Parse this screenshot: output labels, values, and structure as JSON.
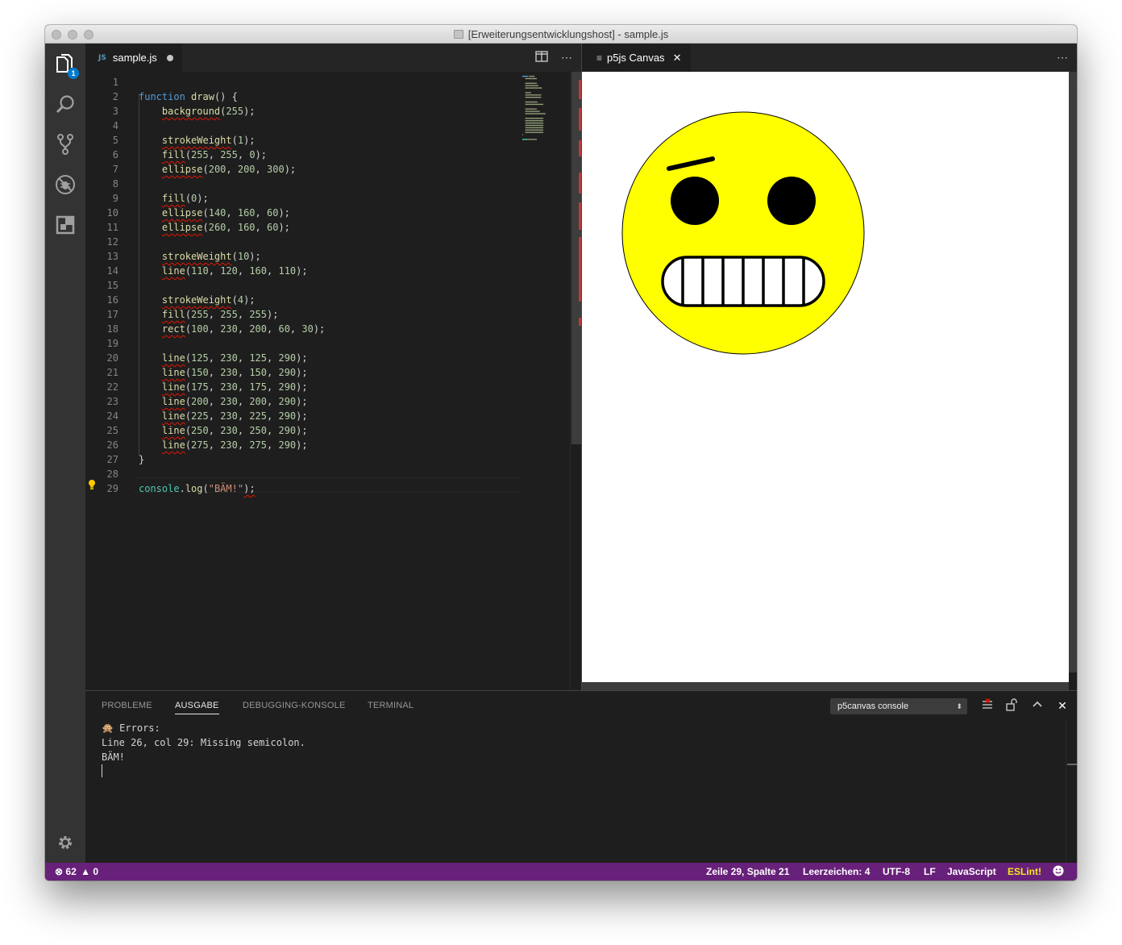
{
  "window": {
    "title": "[Erweiterungsentwicklungshost] - sample.js"
  },
  "activity_bar": {
    "explorer_badge": "1"
  },
  "editor": {
    "tab": {
      "icon_label": "JS",
      "filename": "sample.js"
    },
    "lines": [
      {
        "n": "1",
        "parts": []
      },
      {
        "n": "2",
        "parts": [
          {
            "t": "function",
            "c": "k-kw"
          },
          {
            "t": " "
          },
          {
            "t": "draw",
            "c": "k-fn"
          },
          {
            "t": "() {"
          }
        ]
      },
      {
        "n": "3",
        "parts": [
          {
            "t": "    "
          },
          {
            "t": "background",
            "c": "k-fn squig"
          },
          {
            "t": "("
          },
          {
            "t": "255",
            "c": "k-num"
          },
          {
            "t": ");"
          }
        ]
      },
      {
        "n": "4",
        "parts": []
      },
      {
        "n": "5",
        "parts": [
          {
            "t": "    "
          },
          {
            "t": "strokeWeight",
            "c": "k-fn squig"
          },
          {
            "t": "("
          },
          {
            "t": "1",
            "c": "k-num"
          },
          {
            "t": ");"
          }
        ]
      },
      {
        "n": "6",
        "parts": [
          {
            "t": "    "
          },
          {
            "t": "fill",
            "c": "k-fn squig"
          },
          {
            "t": "("
          },
          {
            "t": "255",
            "c": "k-num"
          },
          {
            "t": ", "
          },
          {
            "t": "255",
            "c": "k-num"
          },
          {
            "t": ", "
          },
          {
            "t": "0",
            "c": "k-num"
          },
          {
            "t": ");"
          }
        ]
      },
      {
        "n": "7",
        "parts": [
          {
            "t": "    "
          },
          {
            "t": "ellipse",
            "c": "k-fn squig"
          },
          {
            "t": "("
          },
          {
            "t": "200",
            "c": "k-num"
          },
          {
            "t": ", "
          },
          {
            "t": "200",
            "c": "k-num"
          },
          {
            "t": ", "
          },
          {
            "t": "300",
            "c": "k-num"
          },
          {
            "t": ");"
          }
        ]
      },
      {
        "n": "8",
        "parts": []
      },
      {
        "n": "9",
        "parts": [
          {
            "t": "    "
          },
          {
            "t": "fill",
            "c": "k-fn squig"
          },
          {
            "t": "("
          },
          {
            "t": "0",
            "c": "k-num"
          },
          {
            "t": ");"
          }
        ]
      },
      {
        "n": "10",
        "parts": [
          {
            "t": "    "
          },
          {
            "t": "ellipse",
            "c": "k-fn squig"
          },
          {
            "t": "("
          },
          {
            "t": "140",
            "c": "k-num"
          },
          {
            "t": ", "
          },
          {
            "t": "160",
            "c": "k-num"
          },
          {
            "t": ", "
          },
          {
            "t": "60",
            "c": "k-num"
          },
          {
            "t": ");"
          }
        ]
      },
      {
        "n": "11",
        "parts": [
          {
            "t": "    "
          },
          {
            "t": "ellipse",
            "c": "k-fn squig"
          },
          {
            "t": "("
          },
          {
            "t": "260",
            "c": "k-num"
          },
          {
            "t": ", "
          },
          {
            "t": "160",
            "c": "k-num"
          },
          {
            "t": ", "
          },
          {
            "t": "60",
            "c": "k-num"
          },
          {
            "t": ");"
          }
        ]
      },
      {
        "n": "12",
        "parts": []
      },
      {
        "n": "13",
        "parts": [
          {
            "t": "    "
          },
          {
            "t": "strokeWeight",
            "c": "k-fn squig"
          },
          {
            "t": "("
          },
          {
            "t": "10",
            "c": "k-num"
          },
          {
            "t": ");"
          }
        ]
      },
      {
        "n": "14",
        "parts": [
          {
            "t": "    "
          },
          {
            "t": "line",
            "c": "k-fn squig"
          },
          {
            "t": "("
          },
          {
            "t": "110",
            "c": "k-num"
          },
          {
            "t": ", "
          },
          {
            "t": "120",
            "c": "k-num"
          },
          {
            "t": ", "
          },
          {
            "t": "160",
            "c": "k-num"
          },
          {
            "t": ", "
          },
          {
            "t": "110",
            "c": "k-num"
          },
          {
            "t": ");"
          }
        ]
      },
      {
        "n": "15",
        "parts": []
      },
      {
        "n": "16",
        "parts": [
          {
            "t": "    "
          },
          {
            "t": "strokeWeight",
            "c": "k-fn squig"
          },
          {
            "t": "("
          },
          {
            "t": "4",
            "c": "k-num"
          },
          {
            "t": ");"
          }
        ]
      },
      {
        "n": "17",
        "parts": [
          {
            "t": "    "
          },
          {
            "t": "fill",
            "c": "k-fn squig"
          },
          {
            "t": "("
          },
          {
            "t": "255",
            "c": "k-num"
          },
          {
            "t": ", "
          },
          {
            "t": "255",
            "c": "k-num"
          },
          {
            "t": ", "
          },
          {
            "t": "255",
            "c": "k-num"
          },
          {
            "t": ");"
          }
        ]
      },
      {
        "n": "18",
        "parts": [
          {
            "t": "    "
          },
          {
            "t": "rect",
            "c": "k-fn squig"
          },
          {
            "t": "("
          },
          {
            "t": "100",
            "c": "k-num"
          },
          {
            "t": ", "
          },
          {
            "t": "230",
            "c": "k-num"
          },
          {
            "t": ", "
          },
          {
            "t": "200",
            "c": "k-num"
          },
          {
            "t": ", "
          },
          {
            "t": "60",
            "c": "k-num"
          },
          {
            "t": ", "
          },
          {
            "t": "30",
            "c": "k-num"
          },
          {
            "t": ");"
          }
        ]
      },
      {
        "n": "19",
        "parts": []
      },
      {
        "n": "20",
        "parts": [
          {
            "t": "    "
          },
          {
            "t": "line",
            "c": "k-fn squig"
          },
          {
            "t": "("
          },
          {
            "t": "125",
            "c": "k-num"
          },
          {
            "t": ", "
          },
          {
            "t": "230",
            "c": "k-num"
          },
          {
            "t": ", "
          },
          {
            "t": "125",
            "c": "k-num"
          },
          {
            "t": ", "
          },
          {
            "t": "290",
            "c": "k-num"
          },
          {
            "t": ");"
          }
        ]
      },
      {
        "n": "21",
        "parts": [
          {
            "t": "    "
          },
          {
            "t": "line",
            "c": "k-fn squig"
          },
          {
            "t": "("
          },
          {
            "t": "150",
            "c": "k-num"
          },
          {
            "t": ", "
          },
          {
            "t": "230",
            "c": "k-num"
          },
          {
            "t": ", "
          },
          {
            "t": "150",
            "c": "k-num"
          },
          {
            "t": ", "
          },
          {
            "t": "290",
            "c": "k-num"
          },
          {
            "t": ");"
          }
        ]
      },
      {
        "n": "22",
        "parts": [
          {
            "t": "    "
          },
          {
            "t": "line",
            "c": "k-fn squig"
          },
          {
            "t": "("
          },
          {
            "t": "175",
            "c": "k-num"
          },
          {
            "t": ", "
          },
          {
            "t": "230",
            "c": "k-num"
          },
          {
            "t": ", "
          },
          {
            "t": "175",
            "c": "k-num"
          },
          {
            "t": ", "
          },
          {
            "t": "290",
            "c": "k-num"
          },
          {
            "t": ");"
          }
        ]
      },
      {
        "n": "23",
        "parts": [
          {
            "t": "    "
          },
          {
            "t": "line",
            "c": "k-fn squig"
          },
          {
            "t": "("
          },
          {
            "t": "200",
            "c": "k-num"
          },
          {
            "t": ", "
          },
          {
            "t": "230",
            "c": "k-num"
          },
          {
            "t": ", "
          },
          {
            "t": "200",
            "c": "k-num"
          },
          {
            "t": ", "
          },
          {
            "t": "290",
            "c": "k-num"
          },
          {
            "t": ");"
          }
        ]
      },
      {
        "n": "24",
        "parts": [
          {
            "t": "    "
          },
          {
            "t": "line",
            "c": "k-fn squig"
          },
          {
            "t": "("
          },
          {
            "t": "225",
            "c": "k-num"
          },
          {
            "t": ", "
          },
          {
            "t": "230",
            "c": "k-num"
          },
          {
            "t": ", "
          },
          {
            "t": "225",
            "c": "k-num"
          },
          {
            "t": ", "
          },
          {
            "t": "290",
            "c": "k-num"
          },
          {
            "t": ");"
          }
        ]
      },
      {
        "n": "25",
        "parts": [
          {
            "t": "    "
          },
          {
            "t": "line",
            "c": "k-fn squig"
          },
          {
            "t": "("
          },
          {
            "t": "250",
            "c": "k-num"
          },
          {
            "t": ", "
          },
          {
            "t": "230",
            "c": "k-num"
          },
          {
            "t": ", "
          },
          {
            "t": "250",
            "c": "k-num"
          },
          {
            "t": ", "
          },
          {
            "t": "290",
            "c": "k-num"
          },
          {
            "t": ");"
          }
        ]
      },
      {
        "n": "26",
        "parts": [
          {
            "t": "    "
          },
          {
            "t": "line",
            "c": "k-fn squig"
          },
          {
            "t": "("
          },
          {
            "t": "275",
            "c": "k-num"
          },
          {
            "t": ", "
          },
          {
            "t": "230",
            "c": "k-num"
          },
          {
            "t": ", "
          },
          {
            "t": "275",
            "c": "k-num"
          },
          {
            "t": ", "
          },
          {
            "t": "290",
            "c": "k-num"
          },
          {
            "t": ");"
          }
        ]
      },
      {
        "n": "27",
        "parts": [
          {
            "t": "}"
          }
        ]
      },
      {
        "n": "28",
        "parts": []
      },
      {
        "n": "29",
        "parts": [
          {
            "t": "console",
            "c": "k-obj"
          },
          {
            "t": "."
          },
          {
            "t": "log",
            "c": "k-fn"
          },
          {
            "t": "("
          },
          {
            "t": "\"BÄM!\"",
            "c": "k-str"
          },
          {
            "t": ");",
            "c": "squig"
          }
        ]
      }
    ]
  },
  "canvas_tab": {
    "title": "p5js Canvas"
  },
  "panel": {
    "tabs": [
      "PROBLEME",
      "AUSGABE",
      "DEBUGGING-KONSOLE",
      "TERMINAL"
    ],
    "active_tab": "AUSGABE",
    "channel": "p5canvas console",
    "output_lines": [
      "🙊 Errors:",
      "Line 26, col 29: Missing semicolon.",
      "BÄM!"
    ]
  },
  "statusbar": {
    "errors": "62",
    "warnings": "0",
    "position": "Zeile 29, Spalte 21",
    "indent": "Leerzeichen: 4",
    "encoding": "UTF-8",
    "eol": "LF",
    "language": "JavaScript",
    "linter": "ESLint!",
    "linter_color": "#f5e71c"
  },
  "colors": {
    "statusbar": "#68217a",
    "accent": "#007acc",
    "face": "#ffff00"
  }
}
